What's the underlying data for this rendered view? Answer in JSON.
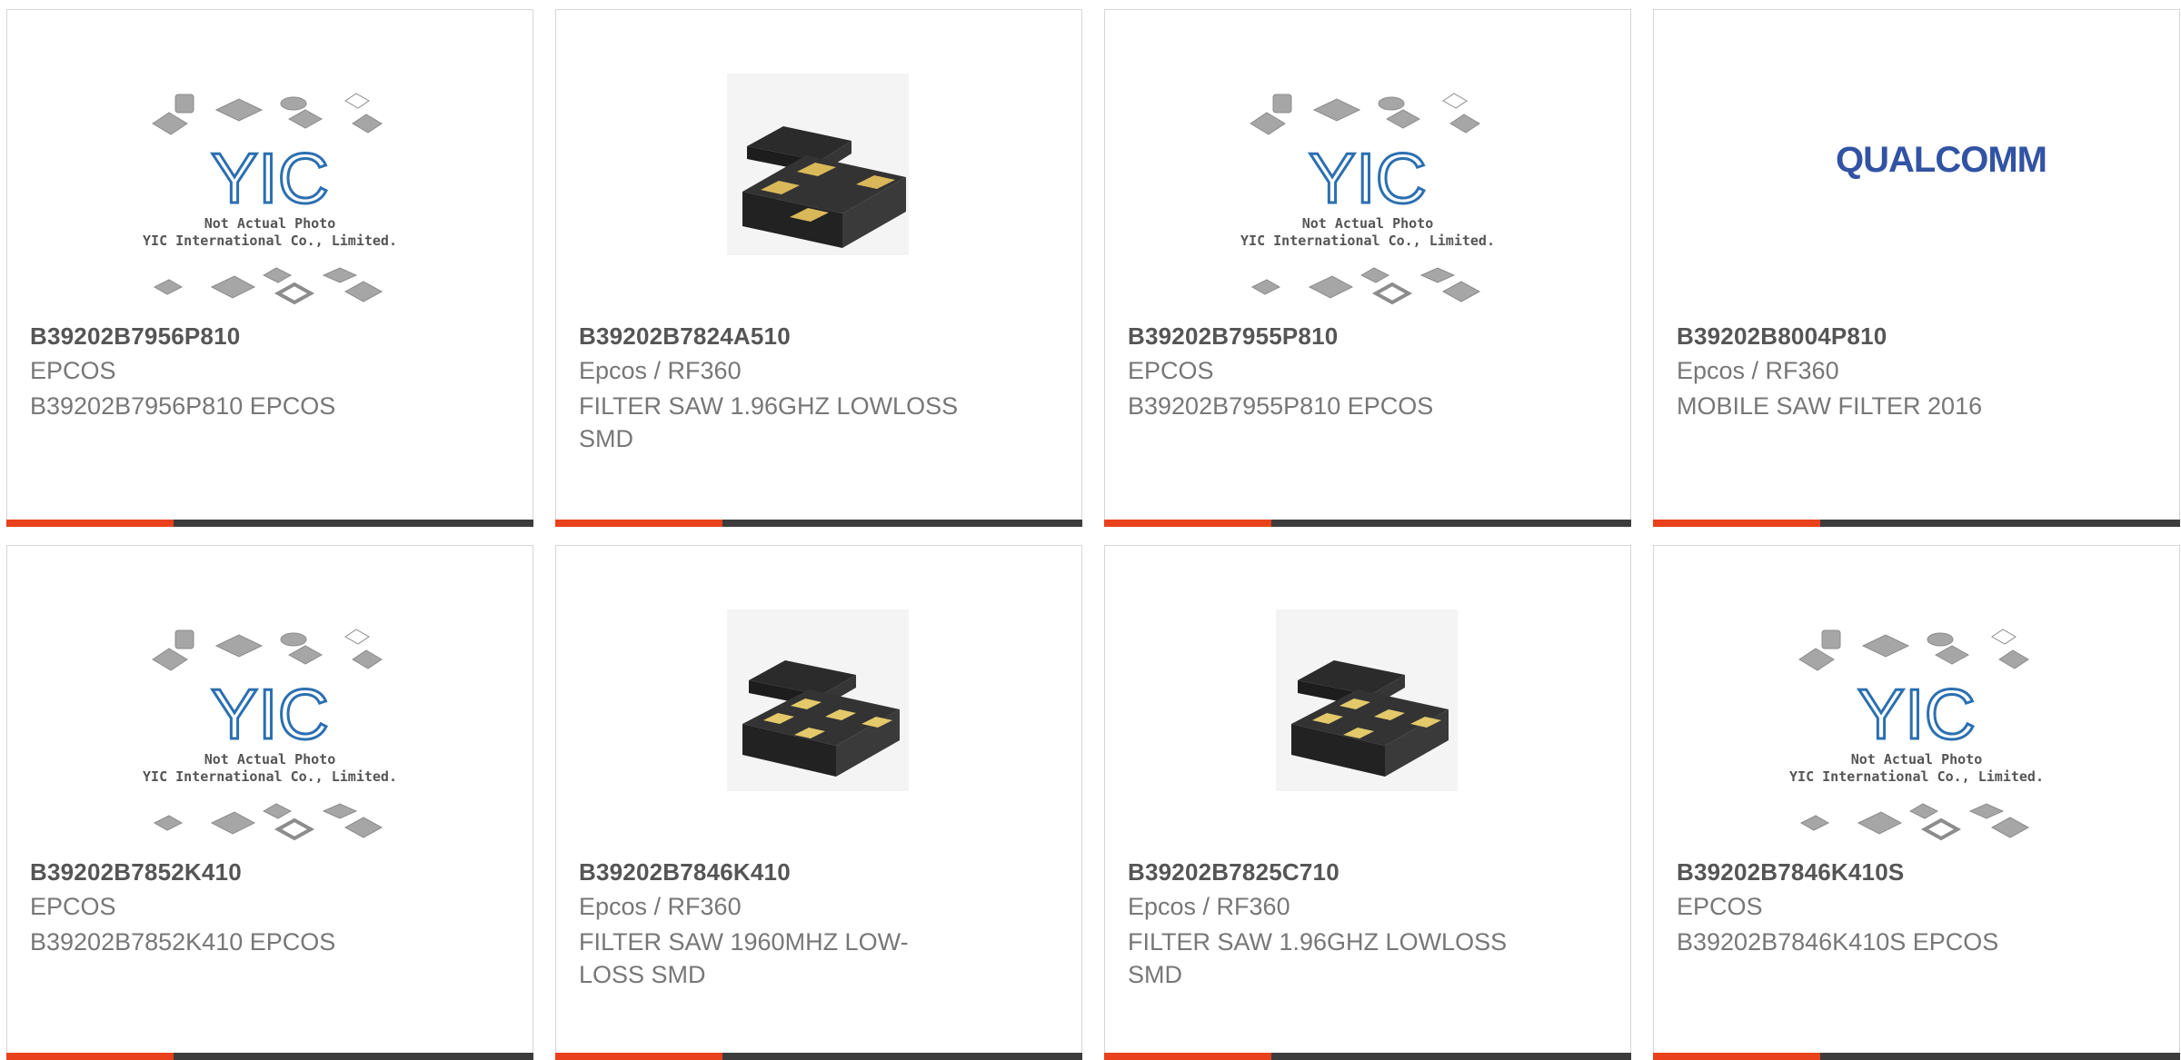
{
  "accent_color": "#e8411c",
  "bar_color": "#3c3c3c",
  "placeholder": {
    "logo_text": "YIC",
    "line1": "Not Actual Photo",
    "line2": "YIC International Co., Limited."
  },
  "qualcomm_logo_text": "QUALCOMM",
  "products": [
    {
      "part": "B39202B7956P810",
      "maker": "EPCOS",
      "desc": "B39202B7956P810 EPCOS",
      "image": "not-actual-photo-placeholder"
    },
    {
      "part": "B39202B7824A510",
      "maker": "Epcos / RF360",
      "desc": "FILTER SAW 1.96GHZ LOWLOSS SMD",
      "image": "saw-filter-4pad-package"
    },
    {
      "part": "B39202B7955P810",
      "maker": "EPCOS",
      "desc": "B39202B7955P810 EPCOS",
      "image": "not-actual-photo-placeholder"
    },
    {
      "part": "B39202B8004P810",
      "maker": "Epcos / RF360",
      "desc": "MOBILE SAW FILTER 2016",
      "image": "qualcomm-logo"
    },
    {
      "part": "B39202B7852K410",
      "maker": "EPCOS",
      "desc": "B39202B7852K410 EPCOS",
      "image": "not-actual-photo-placeholder"
    },
    {
      "part": "B39202B7846K410",
      "maker": "Epcos / RF360",
      "desc": "FILTER SAW 1960MHZ LOW-LOSS SMD",
      "image": "saw-filter-5pad-package"
    },
    {
      "part": "B39202B7825C710",
      "maker": "Epcos / RF360",
      "desc": "FILTER SAW 1.96GHZ LOWLOSS SMD",
      "image": "saw-filter-5pad-package"
    },
    {
      "part": "B39202B7846K410S",
      "maker": "EPCOS",
      "desc": "B39202B7846K410S EPCOS",
      "image": "not-actual-photo-placeholder"
    }
  ]
}
